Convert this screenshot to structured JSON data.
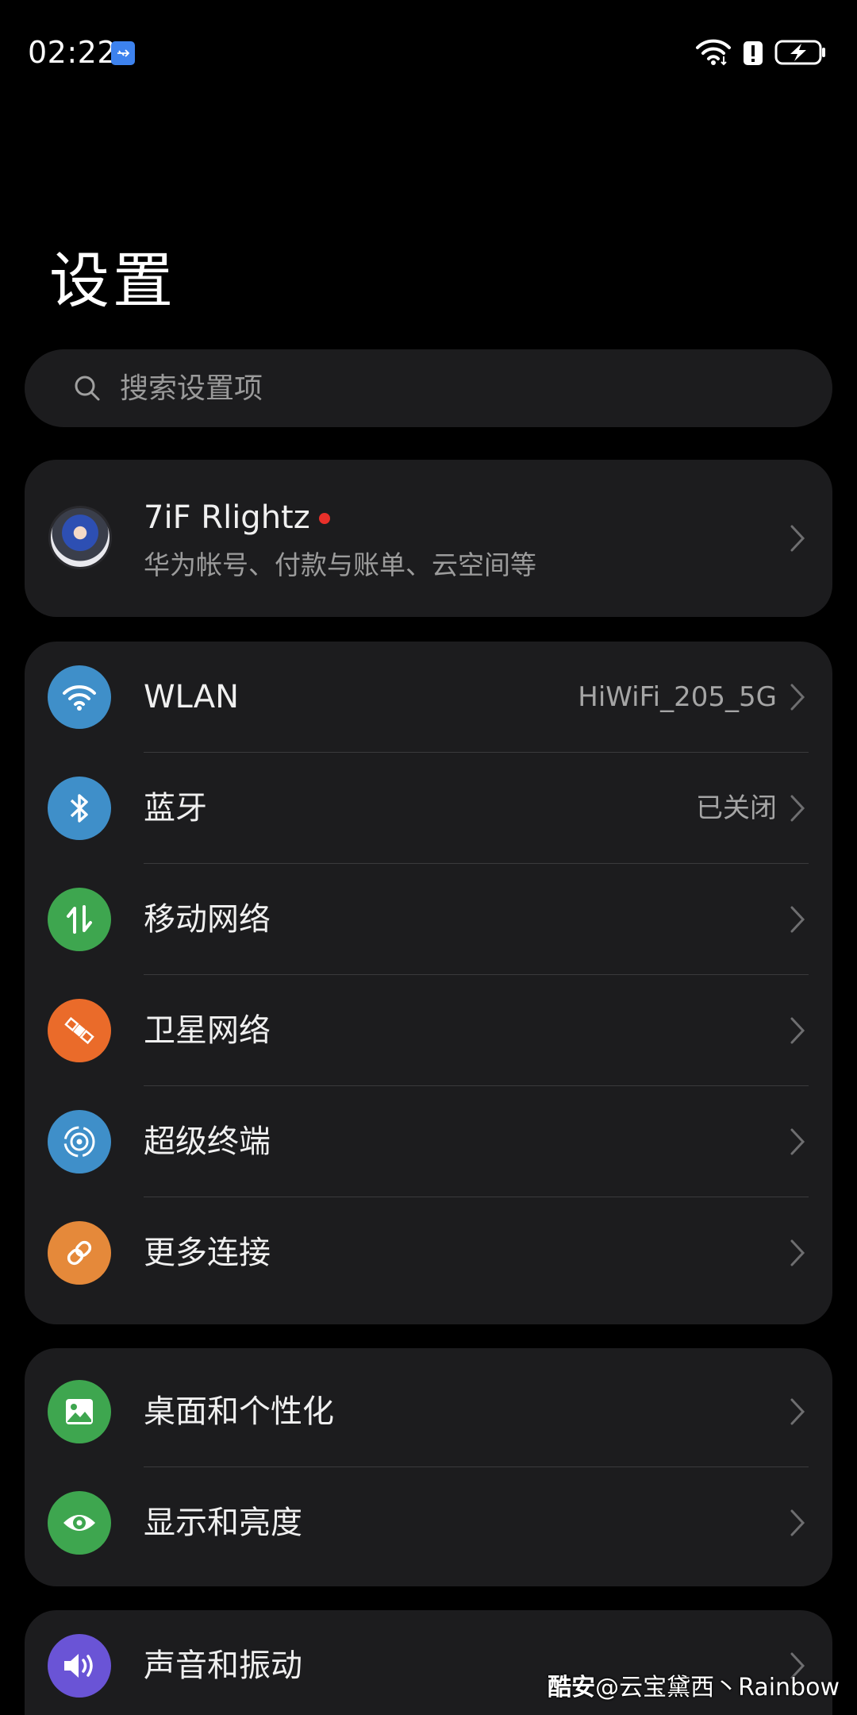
{
  "status_bar": {
    "time": "02:22",
    "icons": [
      "usb-icon",
      "wifi-icon",
      "alert-icon",
      "battery-charging-icon"
    ],
    "usb_color": "#3d82ee"
  },
  "page_title": "设置",
  "search": {
    "placeholder": "搜索设置项",
    "value": ""
  },
  "account": {
    "name": "7iF Rlightz",
    "subtitle": "华为帐号、付款与账单、云空间等",
    "notification_dot_color": "#e8302a"
  },
  "groups": [
    {
      "items": [
        {
          "label": "WLAN",
          "value": "HiWiFi_205_5G",
          "icon": "wifi-icon",
          "color": "#3f8fc9"
        },
        {
          "label": "蓝牙",
          "value": "已关闭",
          "icon": "bluetooth-icon",
          "color": "#3f8fc9"
        },
        {
          "label": "移动网络",
          "value": "",
          "icon": "mobile-data-icon",
          "color": "#3ea64f"
        },
        {
          "label": "卫星网络",
          "value": "",
          "icon": "satellite-icon",
          "color": "#ea6b2a"
        },
        {
          "label": "超级终端",
          "value": "",
          "icon": "super-device-icon",
          "color": "#3f8fc9"
        },
        {
          "label": "更多连接",
          "value": "",
          "icon": "link-icon",
          "color": "#e5893a"
        }
      ]
    },
    {
      "items": [
        {
          "label": "桌面和个性化",
          "value": "",
          "icon": "wallpaper-icon",
          "color": "#3ea64f"
        },
        {
          "label": "显示和亮度",
          "value": "",
          "icon": "eye-icon",
          "color": "#3ea64f"
        }
      ]
    },
    {
      "items": [
        {
          "label": "声音和振动",
          "value": "",
          "icon": "sound-icon",
          "color": "#6a54d6"
        }
      ]
    }
  ],
  "watermark": {
    "brand": "酷安",
    "text": "@云宝黛西丶Rainbow"
  }
}
